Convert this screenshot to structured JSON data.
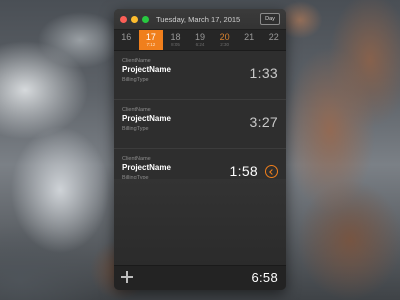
{
  "window": {
    "title": "Tuesday, March 17, 2015",
    "view_button": "Day"
  },
  "dates": [
    {
      "num": "16",
      "sub": "",
      "selected": false,
      "weekend": false
    },
    {
      "num": "17",
      "sub": "7:12",
      "selected": true,
      "weekend": false
    },
    {
      "num": "18",
      "sub": "8:05",
      "selected": false,
      "weekend": false
    },
    {
      "num": "19",
      "sub": "6:24",
      "selected": false,
      "weekend": false
    },
    {
      "num": "20",
      "sub": "2:30",
      "selected": false,
      "weekend": true
    },
    {
      "num": "21",
      "sub": "",
      "selected": false,
      "weekend": false
    },
    {
      "num": "22",
      "sub": "",
      "selected": false,
      "weekend": false
    }
  ],
  "entries": [
    {
      "client": "ClientName",
      "project": "ProjectName",
      "billing": "BillingType",
      "duration": "1:33"
    },
    {
      "client": "ClientName",
      "project": "ProjectName",
      "billing": "BillingType",
      "duration": "3:27"
    },
    {
      "client": "ClientName",
      "project": "ProjectName",
      "billing": "BillingType",
      "duration": "1:58"
    }
  ],
  "footer": {
    "total": "6:58"
  },
  "colors": {
    "accent": "#f07f1c"
  },
  "icons": {
    "add": "plus-icon",
    "timer": "chevron-left-circle-icon"
  }
}
